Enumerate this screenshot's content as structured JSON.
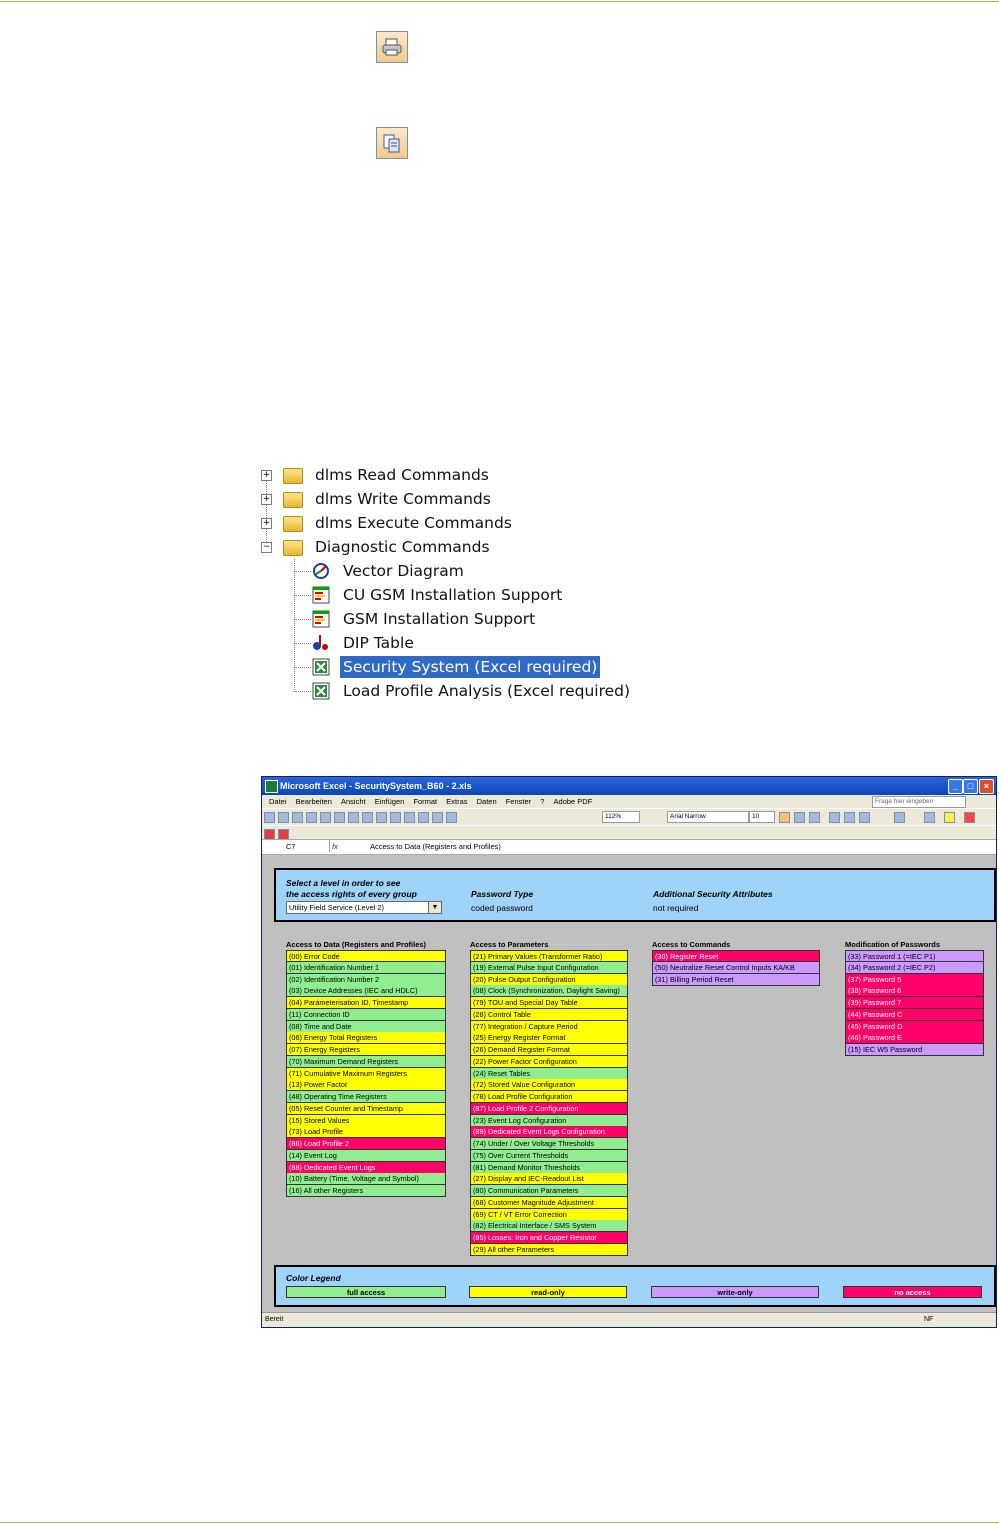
{
  "tree": {
    "items": [
      {
        "label": "dlms Read Commands",
        "expander": "+"
      },
      {
        "label": "dlms Write Commands",
        "expander": "+"
      },
      {
        "label": "dlms Execute Commands",
        "expander": "+"
      },
      {
        "label": "Diagnostic Commands",
        "expander": "−"
      }
    ],
    "children": [
      {
        "label": "Vector Diagram",
        "icon": "vector-diagram-icon"
      },
      {
        "label": "CU GSM Installation Support",
        "icon": "bar-chart-icon"
      },
      {
        "label": "GSM Installation Support",
        "icon": "bar-chart-icon"
      },
      {
        "label": "DIP Table",
        "icon": "dip-table-icon"
      },
      {
        "label": "Security System (Excel required)",
        "icon": "excel-icon"
      },
      {
        "label": "Load Profile Analysis (Excel required)",
        "icon": "excel-icon"
      }
    ]
  },
  "excel": {
    "title": "Microsoft Excel - SecuritySystem_B60 - 2.xls",
    "menu": [
      "Datei",
      "Bearbeiten",
      "Ansicht",
      "Einfügen",
      "Format",
      "Extras",
      "Daten",
      "Fenster",
      "?",
      "Adobe PDF"
    ],
    "help_placeholder": "Frage hier eingeben",
    "zoom": "112%",
    "font": "Arial Narrow",
    "font_size": "10",
    "cell_ref": "C7",
    "formula": "Access to Data (Registers and Profiles)",
    "status": "Bereit",
    "status_right": "NF",
    "header": {
      "select_label_1": "Select a level in order to see",
      "select_label_2": "the access rights of every group",
      "select_value": "Utility Field Service (Level 2)",
      "password_type_label": "Password Type",
      "password_type_value": "coded password",
      "security_label": "Additional Security Attributes",
      "security_value": "not required"
    },
    "col1_title": "Access to Data (Registers and Profiles)",
    "col1": [
      {
        "t": "(00) Error Code",
        "c": "y"
      },
      {
        "t": "(01) Identification Number 1",
        "c": "g"
      },
      {
        "t": "(02) Identification Number 2",
        "c": "g"
      },
      {
        "t": "(03) Device Addresses (IEC and HDLC)",
        "c": "g"
      },
      {
        "t": "(04) Parameterisation ID, Timestamp",
        "c": "y"
      },
      {
        "t": "(11) Connection ID",
        "c": "g"
      },
      {
        "t": "(08) Time and Date",
        "c": "g"
      },
      {
        "t": "(06) Energy Total Registers",
        "c": "y"
      },
      {
        "t": "(07) Energy Registers",
        "c": "y"
      },
      {
        "t": "(70) Maximum Demand Registers",
        "c": "g"
      },
      {
        "t": "(71) Cumulative Maximum Registers",
        "c": "y"
      },
      {
        "t": "(13) Power Factor",
        "c": "y"
      },
      {
        "t": "(48) Operating Time Registers",
        "c": "g"
      },
      {
        "t": "(05) Reset Counter and Timestamp",
        "c": "y"
      },
      {
        "t": "(15) Stored Values",
        "c": "y"
      },
      {
        "t": "(73) Load Profile",
        "c": "y"
      },
      {
        "t": "(86) Load Profile 2",
        "c": "r"
      },
      {
        "t": "(14) Event Log",
        "c": "g"
      },
      {
        "t": "(88) Dedicated Event Logs",
        "c": "r"
      },
      {
        "t": "(10) Battery (Time, Voltage and Symbol)",
        "c": "g"
      },
      {
        "t": "(16) All other Registers",
        "c": "g"
      }
    ],
    "col2_title": "Access to Parameters",
    "col2": [
      {
        "t": "(21) Primary Values (Transformer Ratio)",
        "c": "y"
      },
      {
        "t": "(19) External Pulse Input Configuration",
        "c": "g"
      },
      {
        "t": "(20) Pulse Output Configuration",
        "c": "y"
      },
      {
        "t": "(08) Clock (Synchronization, Daylight Saving)",
        "c": "g"
      },
      {
        "t": "(79) TOU and Special Day Table",
        "c": "y"
      },
      {
        "t": "(28) Control Table",
        "c": "y"
      },
      {
        "t": "(77) Integration / Capture Period",
        "c": "y"
      },
      {
        "t": "(25) Energy Register Format",
        "c": "y"
      },
      {
        "t": "(26) Demand Register Format",
        "c": "y"
      },
      {
        "t": "(22) Power Factor Configuration",
        "c": "y"
      },
      {
        "t": "(24) Reset Tables",
        "c": "g"
      },
      {
        "t": "(72) Stored Value Configuration",
        "c": "y"
      },
      {
        "t": "(78) Load Profile Configuration",
        "c": "y"
      },
      {
        "t": "(87) Load Profile 2 Configuration",
        "c": "r"
      },
      {
        "t": "(23) Event Log Configuration",
        "c": "g"
      },
      {
        "t": "(89) Dedicated Event Logs Configuration",
        "c": "r"
      },
      {
        "t": "(74) Under / Over Voltage Thresholds",
        "c": "g"
      },
      {
        "t": "(75) Over Current Thresholds",
        "c": "g"
      },
      {
        "t": "(81) Demand Monitor Thresholds",
        "c": "g"
      },
      {
        "t": "(27) Display and IEC-Readout List",
        "c": "y"
      },
      {
        "t": "(80) Communication Parameters",
        "c": "g"
      },
      {
        "t": "(68) Customer Magnitude Adjustment",
        "c": "y"
      },
      {
        "t": "(69) CT / VT Error Correction",
        "c": "y"
      },
      {
        "t": "(82) Electrical Interface / SMS System",
        "c": "g"
      },
      {
        "t": "(85) Losses: Iron and Copper Resistor",
        "c": "r"
      },
      {
        "t": "(29) All other Parameters",
        "c": "y"
      }
    ],
    "col3_title": "Access to Commands",
    "col3": [
      {
        "t": "(30) Register Reset",
        "c": "r"
      },
      {
        "t": "(50) Neutralize Reset Control Inputs KA/KB",
        "c": "p"
      },
      {
        "t": "(31) Billing Period Reset",
        "c": "p"
      }
    ],
    "col4_title": "Modification of Passwords",
    "col4": [
      {
        "t": "(33) Password 1 (=IEC P1)",
        "c": "p"
      },
      {
        "t": "(34) Password 2 (=IEC P2)",
        "c": "p"
      },
      {
        "t": "(37) Password 5",
        "c": "r"
      },
      {
        "t": "(38) Password 6",
        "c": "r"
      },
      {
        "t": "(39) Password 7",
        "c": "r"
      },
      {
        "t": "(44) Password C",
        "c": "r"
      },
      {
        "t": "(45) Password D",
        "c": "r"
      },
      {
        "t": "(46) Password E",
        "c": "r"
      },
      {
        "t": "(15) IEC W5 Password",
        "c": "p"
      }
    ],
    "legend_title": "Color Legend",
    "legend": [
      {
        "t": "full access",
        "c": "g"
      },
      {
        "t": "read-only",
        "c": "y"
      },
      {
        "t": "write-only",
        "c": "p"
      },
      {
        "t": "no access",
        "c": "r"
      }
    ]
  }
}
